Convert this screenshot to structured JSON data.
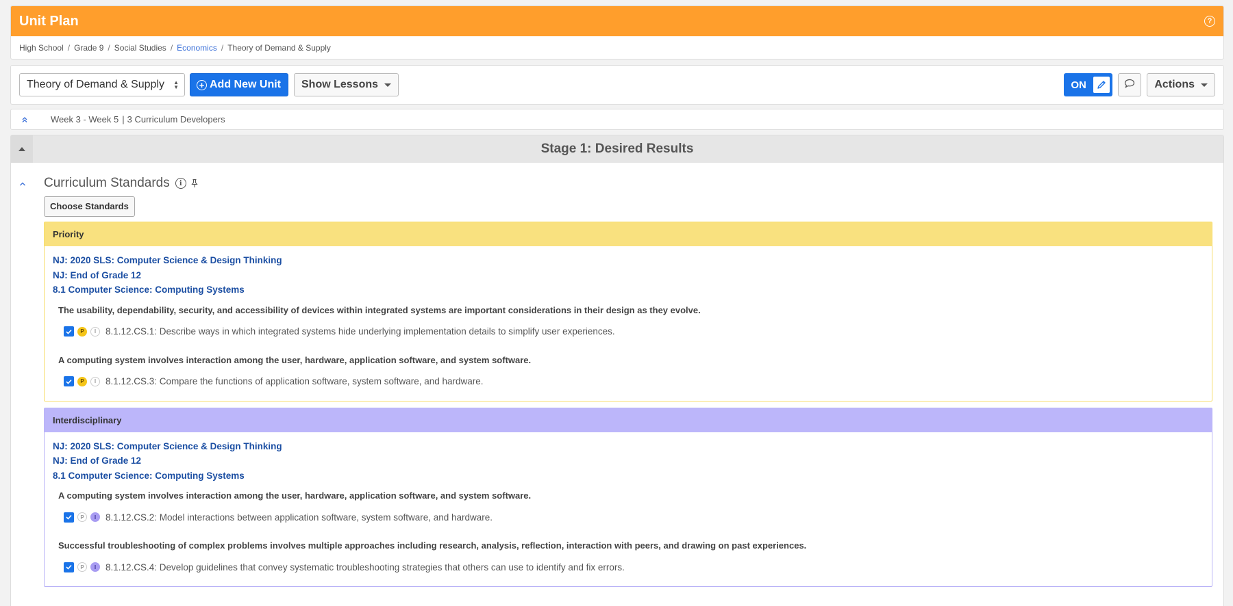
{
  "header": {
    "title": "Unit Plan",
    "help_icon": "question-circle-icon"
  },
  "breadcrumb": [
    "High School",
    "Grade 9",
    "Social Studies",
    "Economics",
    "Theory of Demand & Supply"
  ],
  "toolbar": {
    "unit_select": "Theory of Demand & Supply",
    "add_unit_label": "Add New Unit",
    "show_lessons_label": "Show Lessons",
    "toggle_label": "ON",
    "actions_label": "Actions"
  },
  "info": {
    "weeks": "Week 3 - Week 5",
    "developers": "3 Curriculum Developers"
  },
  "stage": {
    "title": "Stage 1: Desired Results"
  },
  "standards": {
    "title": "Curriculum Standards",
    "choose_label": "Choose Standards",
    "groups": [
      {
        "label": "Priority",
        "links": [
          "NJ: 2020 SLS: Computer Science & Design Thinking",
          "NJ: End of Grade 12",
          "8.1 Computer Science: Computing Systems"
        ],
        "items": [
          {
            "desc": "The usability, dependability, security, and accessibility of devices within integrated systems are important considerations in their design as they evolve.",
            "code": "8.1.12.CS.1: Describe ways in which integrated systems hide underlying implementation details to simplify user experiences.",
            "p": "P",
            "i": "I"
          },
          {
            "desc": "A computing system involves interaction among the user, hardware, application software, and system software.",
            "code": "8.1.12.CS.3: Compare the functions of application software, system software, and hardware.",
            "p": "P",
            "i": "I"
          }
        ]
      },
      {
        "label": "Interdisciplinary",
        "links": [
          "NJ: 2020 SLS: Computer Science & Design Thinking",
          "NJ: End of Grade 12",
          "8.1 Computer Science: Computing Systems"
        ],
        "items": [
          {
            "desc": "A computing system involves interaction among the user, hardware, application software, and system software.",
            "code": "8.1.12.CS.2: Model interactions between application software, system software, and hardware.",
            "p": "P",
            "i": "I"
          },
          {
            "desc": "Successful troubleshooting of complex problems involves multiple approaches including research, analysis, reflection, interaction with peers, and drawing on past experiences.",
            "code": "8.1.12.CS.4: Develop guidelines that convey systematic troubleshooting strategies that others can use to identify and fix errors.",
            "p": "P",
            "i": "I"
          }
        ]
      }
    ]
  },
  "colors": {
    "header_orange": "#ff9e2c",
    "primary_blue": "#1a73e8",
    "priority_yellow": "#f9e17f",
    "interdisciplinary_purple": "#bcb6fa",
    "link_blue": "#1c4fa3"
  }
}
